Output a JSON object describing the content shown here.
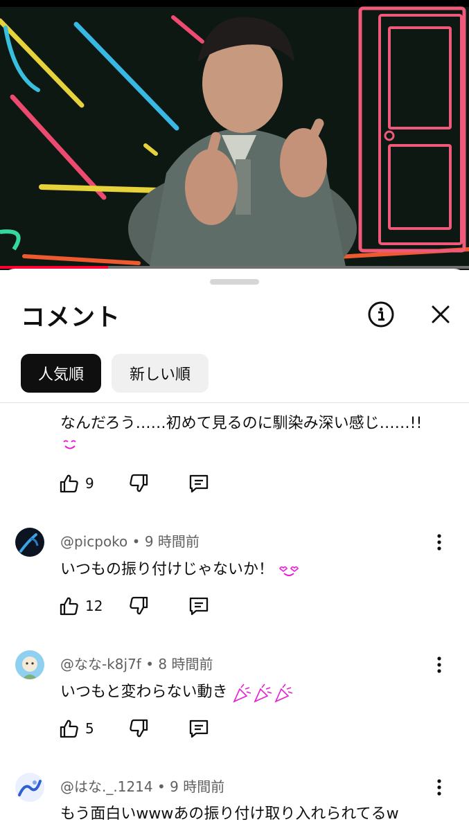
{
  "video": {
    "progress": 0.23
  },
  "sheet": {
    "title": "コメント",
    "chips": [
      {
        "label": "人気順",
        "active": true
      },
      {
        "label": "新しい順",
        "active": false
      }
    ]
  },
  "comments": [
    {
      "text": "なんだろう……初めて見るのに馴染み深い感じ……!!",
      "emoji": "relieved-face",
      "likes": "9"
    },
    {
      "author": "@picpoko",
      "time": "9 時間前",
      "text": "いつもの振り付けじゃないか！",
      "emoji": "smiling-face-with-hearts",
      "likes": "12"
    },
    {
      "author": "@なな-k8j7f",
      "time": "8 時間前",
      "text": "いつもと変わらない動き",
      "emoji": "party-popper x3",
      "likes": "5"
    },
    {
      "author": "@はな._.1214",
      "time": "9 時間前",
      "text": "もう面白いwwwあの振り付け取り入れられてるw"
    }
  ],
  "icons": {
    "info": "info-icon",
    "close": "close-icon",
    "like": "thumbs-up-icon",
    "dislike": "thumbs-down-icon",
    "reply": "reply-icon",
    "more": "more-vert-icon"
  },
  "colors": {
    "accent_red": "#ff0033",
    "emoji_magenta": "#e81cd6",
    "text_primary": "#0f0f0f",
    "text_secondary": "#606060",
    "chip_active_bg": "#0f0f0f",
    "chip_inactive_bg": "#f0f0f0"
  }
}
